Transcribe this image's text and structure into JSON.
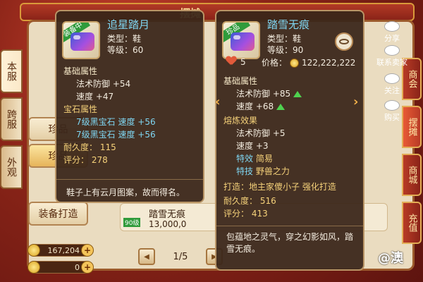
{
  "header": {
    "title": "摆摊"
  },
  "left_tabs": [
    "本服",
    "跨服",
    "外观"
  ],
  "categories": [
    "珍品",
    "珍品",
    "装备打造"
  ],
  "right_tabs": [
    "商会",
    "摆摊",
    "商城",
    "充值"
  ],
  "side_actions": [
    {
      "label": "分享",
      "icon": "share-icon"
    },
    {
      "label": "联系卖家",
      "icon": "chat-icon"
    },
    {
      "label": "关注",
      "icon": "heart-icon"
    },
    {
      "label": "购买",
      "icon": "buy-icon"
    }
  ],
  "wallet": {
    "silver": "167,204",
    "gold": "0"
  },
  "pager": {
    "text": "1/5"
  },
  "background_item": {
    "name": "踏雪无痕",
    "price": "13,000,0",
    "level_tag": "90级"
  },
  "tooltip_equipped": {
    "badge": "装备中",
    "name": "追星踏月",
    "type": "类型：鞋",
    "level": "等级：60",
    "base_title": "基础属性",
    "base_attrs": [
      "法术防御 +54",
      "速度 +47"
    ],
    "gem_title": "宝石属性",
    "gem_attrs": [
      "7级黑宝石  速度 +56",
      "7级黑宝石  速度 +56"
    ],
    "durability": "耐久度： 115",
    "score": "评分： 278",
    "description": "鞋子上有云月图案，故而得名。"
  },
  "tooltip_item": {
    "badge": "珍品",
    "name": "踏雪无痕",
    "type": "类型：鞋",
    "level": "等级：90",
    "likes": "5",
    "price_label": "价格：",
    "price": "122,222,222",
    "base_title": "基础属性",
    "base_attrs": [
      "法术防御 +85",
      "速度 +68"
    ],
    "refine_title": "熔炼效果",
    "refine_attrs": [
      "法术防御 +5",
      "速度 +3"
    ],
    "special1_label": "特效",
    "special1": "简易",
    "special2_label": "特技",
    "special2": "野兽之力",
    "forge": "打造：地主家傻小子   强化打造",
    "durability": "耐久度： 516",
    "score": "评分： 413",
    "description": "包蕴地之灵气，穿之幻影如风，踏雪无痕。"
  },
  "watermark": "@澳"
}
